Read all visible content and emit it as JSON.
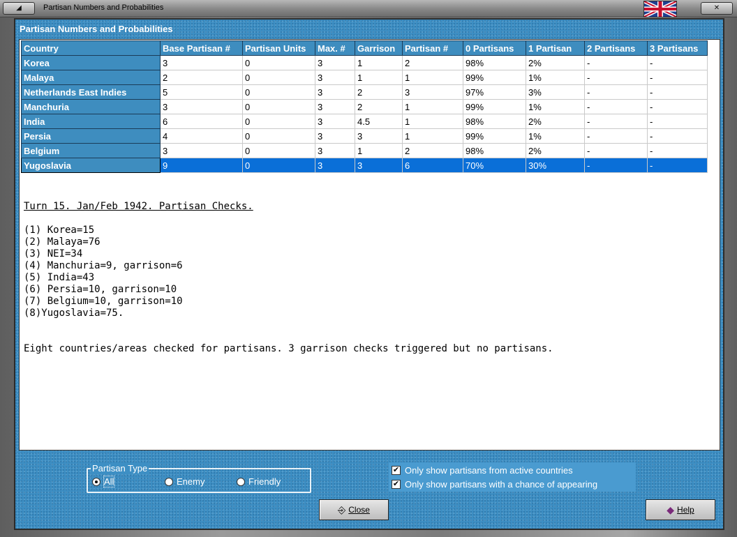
{
  "window": {
    "title": "Partisan Numbers and Probabilities",
    "left_button": "◢",
    "close_button": "✕"
  },
  "panel": {
    "title": "Partisan Numbers and Probabilities"
  },
  "table": {
    "columns": [
      "Country",
      "Base Partisan #",
      "Partisan Units",
      "Max. #",
      "Garrison",
      "Partisan #",
      "0 Partisans",
      "1 Partisan",
      "2 Partisans",
      "3 Partisans"
    ],
    "rows": [
      [
        "Korea",
        "3",
        "0",
        "3",
        "1",
        "2",
        "98%",
        "2%",
        "-",
        "-"
      ],
      [
        "Malaya",
        "2",
        "0",
        "3",
        "1",
        "1",
        "99%",
        "1%",
        "-",
        "-"
      ],
      [
        "Netherlands East Indies",
        "5",
        "0",
        "3",
        "2",
        "3",
        "97%",
        "3%",
        "-",
        "-"
      ],
      [
        "Manchuria",
        "3",
        "0",
        "3",
        "2",
        "1",
        "99%",
        "1%",
        "-",
        "-"
      ],
      [
        "India",
        "6",
        "0",
        "3",
        "4.5",
        "1",
        "98%",
        "2%",
        "-",
        "-"
      ],
      [
        "Persia",
        "4",
        "0",
        "3",
        "3",
        "1",
        "99%",
        "1%",
        "-",
        "-"
      ],
      [
        "Belgium",
        "3",
        "0",
        "3",
        "1",
        "2",
        "98%",
        "2%",
        "-",
        "-"
      ],
      [
        "Yugoslavia",
        "9",
        "0",
        "3",
        "3",
        "6",
        "70%",
        "30%",
        "-",
        "-"
      ]
    ],
    "selected_row": 7
  },
  "notes": {
    "header": "Turn 15. Jan/Feb 1942. Partisan Checks.",
    "lines": [
      "(1) Korea=15",
      "(2) Malaya=76",
      "(3) NEI=34",
      "(4) Manchuria=9, garrison=6",
      "(5) India=43",
      "(6) Persia=10, garrison=10",
      "(7) Belgium=10, garrison=10",
      "(8)Yugoslavia=75."
    ],
    "summary": "Eight countries/areas checked for partisans. 3 garrison checks triggered but no partisans."
  },
  "partisan_type": {
    "legend": "Partisan Type",
    "options": [
      {
        "label": "All",
        "selected": true
      },
      {
        "label": "Enemy",
        "selected": false
      },
      {
        "label": "Friendly",
        "selected": false
      }
    ]
  },
  "filters": {
    "active_countries": {
      "label": "Only show partisans from active countries",
      "checked": true
    },
    "chance": {
      "label": "Only show partisans with a chance of appearing",
      "checked": true
    }
  },
  "buttons": {
    "close": "Close",
    "help": "Help"
  },
  "colors": {
    "panel_blue": "#3d8fc4",
    "header_blue": "#3e8dbf",
    "selected_row": "#0a6fd8"
  }
}
